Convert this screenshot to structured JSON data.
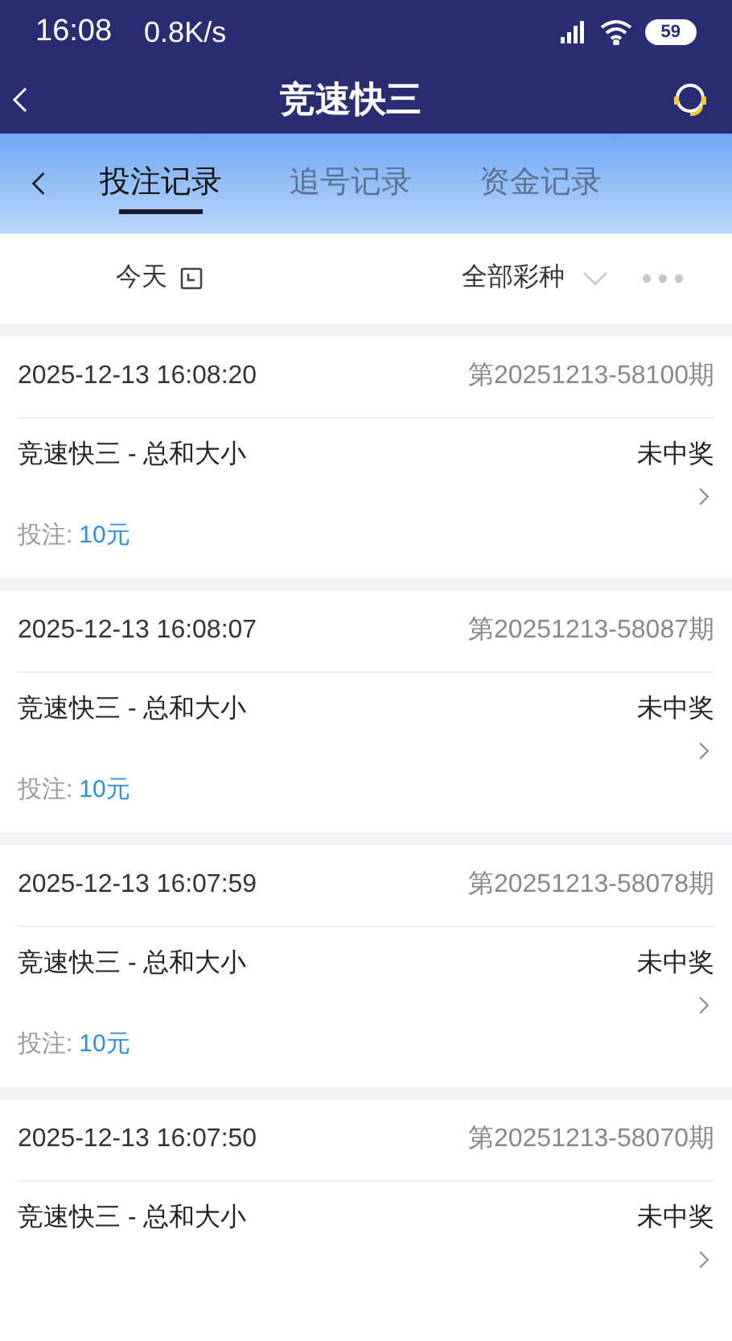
{
  "status_bar": {
    "time": "16:08",
    "speed": "0.8K/s",
    "battery": "59"
  },
  "header": {
    "title": "竞速快三"
  },
  "tabs": [
    {
      "label": "投注记录",
      "selected": true
    },
    {
      "label": "追号记录",
      "selected": false
    },
    {
      "label": "资金记录",
      "selected": false
    }
  ],
  "filters": {
    "date": "今天",
    "lottery": "全部彩种"
  },
  "records": [
    {
      "time": "2025-12-13 16:08:20",
      "issue": "第20251213-58100期",
      "game": "竞速快三 - 总和大小",
      "result": "未中奖",
      "bet_label": "投注:",
      "bet_amount": "10元"
    },
    {
      "time": "2025-12-13 16:08:07",
      "issue": "第20251213-58087期",
      "game": "竞速快三 - 总和大小",
      "result": "未中奖",
      "bet_label": "投注:",
      "bet_amount": "10元"
    },
    {
      "time": "2025-12-13 16:07:59",
      "issue": "第20251213-58078期",
      "game": "竞速快三 - 总和大小",
      "result": "未中奖",
      "bet_label": "投注:",
      "bet_amount": "10元"
    },
    {
      "time": "2025-12-13 16:07:50",
      "issue": "第20251213-58070期",
      "game": "竞速快三 - 总和大小",
      "result": "未中奖"
    }
  ]
}
